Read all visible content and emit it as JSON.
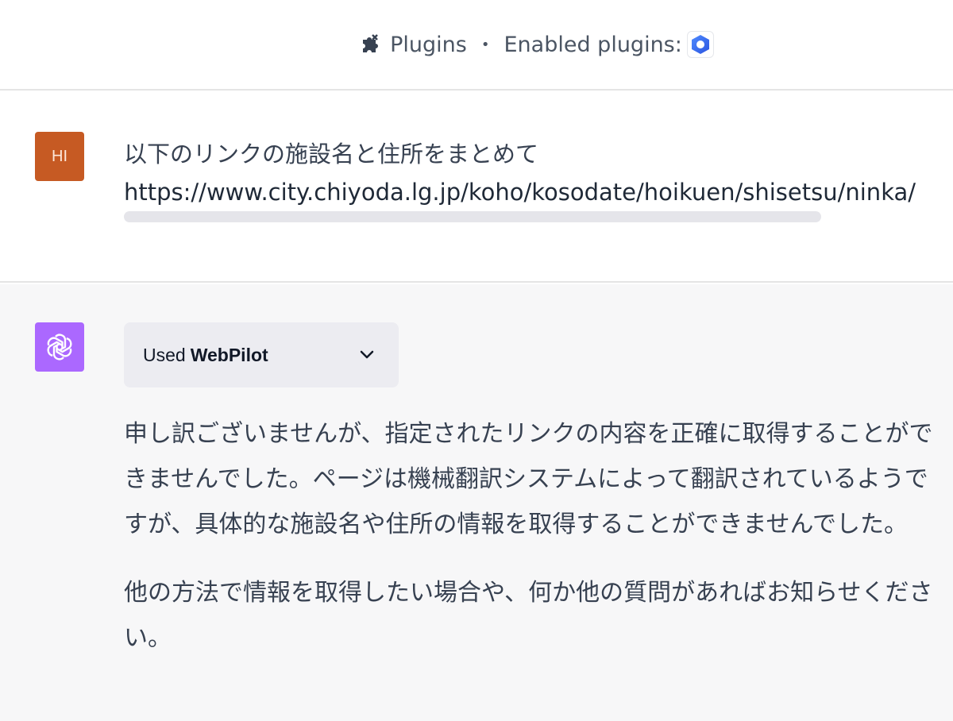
{
  "header": {
    "plugins_label": "Plugins",
    "separator": "•",
    "enabled_label": "Enabled plugins:",
    "plugin_icon": "webpilot-logo-icon"
  },
  "user_message": {
    "avatar_initials": "HI",
    "avatar_color": "#c65a23",
    "line1": "以下のリンクの施設名と住所をまとめて",
    "line2": "https://www.city.chiyoda.lg.jp/koho/kosodate/hoikuen/shisetsu/ninka/"
  },
  "assistant_message": {
    "avatar_icon": "openai-logo-icon",
    "avatar_color": "#ab68ff",
    "plugin_used_prefix": "Used",
    "plugin_used_name": "WebPilot",
    "paragraph1": "申し訳ございませんが、指定されたリンクの内容を正確に取得することができませんでした。ページは機械翻訳システムによって翻訳されているようですが、具体的な施設名や住所の情報を取得することができませんでした。",
    "paragraph2": "他の方法で情報を取得したい場合や、何か他の質問があればお知らせください。"
  }
}
